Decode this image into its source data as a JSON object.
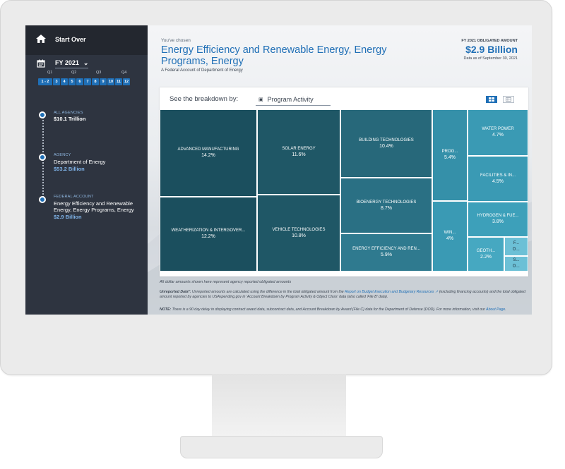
{
  "sidebar": {
    "start_over": "Start Over",
    "fy_label": "FY 2021",
    "quarters": [
      "Q1",
      "Q2",
      "Q3",
      "Q4"
    ],
    "periods": [
      "1 - 2",
      "3",
      "4",
      "5",
      "6",
      "7",
      "8",
      "9",
      "10",
      "11",
      "12"
    ],
    "breadcrumbs": [
      {
        "label": "ALL AGENCIES",
        "name": "",
        "amount": "$10.1 Trillion"
      },
      {
        "label": "AGENCY",
        "name": "Department of Energy",
        "amount": "$53.2 Billion"
      },
      {
        "label": "FEDERAL ACCOUNT",
        "name": "Energy Efficiency and Renewable Energy, Energy Programs, Energy",
        "amount": "$2.9 Billion"
      }
    ]
  },
  "header": {
    "chosen": "You've chosen",
    "title": "Energy Efficiency and Renewable Energy, Energy Programs, Energy",
    "subtitle": "A Federal Account of Department of Energy",
    "obligated_label": "FY 2021 OBLIGATED AMOUNT",
    "obligated_amount": "$2.9 Billion",
    "data_as_of": "Data as of September 30, 2021"
  },
  "breakdown": {
    "see_label": "See the breakdown by:",
    "selected": "Program Activity",
    "icons": {
      "dropdown": "briefcase-icon",
      "treemap_view": "grid-icon",
      "table_view": "table-icon"
    }
  },
  "treemap": [
    {
      "name": "ADVANCED MANUFACTURING",
      "pct": "14.2%",
      "color": "#1b4f5e"
    },
    {
      "name": "WEATHERIZATION & INTERGOVER...",
      "pct": "12.2%",
      "color": "#1b4f5e"
    },
    {
      "name": "SOLAR ENERGY",
      "pct": "11.6%",
      "color": "#1f5766"
    },
    {
      "name": "VEHICLE TECHNOLOGIES",
      "pct": "10.8%",
      "color": "#1f5766"
    },
    {
      "name": "BUILDING TECHNOLOGIES",
      "pct": "10.4%",
      "color": "#27687a"
    },
    {
      "name": "BIOENERGY TECHNOLOGIES",
      "pct": "8.7%",
      "color": "#2a7084"
    },
    {
      "name": "ENERGY EFFICIENCY AND REN...",
      "pct": "5.9%",
      "color": "#2f7a8f"
    },
    {
      "name": "PROG...",
      "pct": "5.4%",
      "color": "#3590a9"
    },
    {
      "name": "WIN...",
      "pct": "4%",
      "color": "#3a9ab4"
    },
    {
      "name": "WATER POWER",
      "pct": "4.7%",
      "color": "#3a9ab4"
    },
    {
      "name": "FACILITIES & IN...",
      "pct": "4.5%",
      "color": "#3a9ab4"
    },
    {
      "name": "HYDROGEN & FUE...",
      "pct": "3.8%",
      "color": "#3da0ba"
    },
    {
      "name": "GEOTH...",
      "pct": "2.2%",
      "color": "#46a8c1"
    },
    {
      "name": "F...",
      "pct": "0...",
      "color": "#6cc0d6"
    },
    {
      "name": "S...",
      "pct": "0...",
      "color": "#6cc0d6"
    }
  ],
  "footnotes": {
    "note1": "All dollar amounts shown here represent agency reported obligated amounts",
    "unreported_label": "Unreported Data*:",
    "unreported_text_a": "Unreported amounts are calculated using the difference in the total obligated amount from the",
    "unreported_link": "Report on Budget Execution and Budgetary Resources",
    "unreported_text_b": "(excluding financing accounts) and the total obligated amount reported by agencies to USAspending.gov in 'Account Breakdown by Program Activity & Object Class' data (also called 'File B' data).",
    "note_label": "NOTE:",
    "note_text": "There is a 90 day delay in displaying contract award data, subcontract data, and Account Breakdown by Award (File C) data for the Department of Defense (DOD). For more information, visit our",
    "about_link": "About Page"
  }
}
